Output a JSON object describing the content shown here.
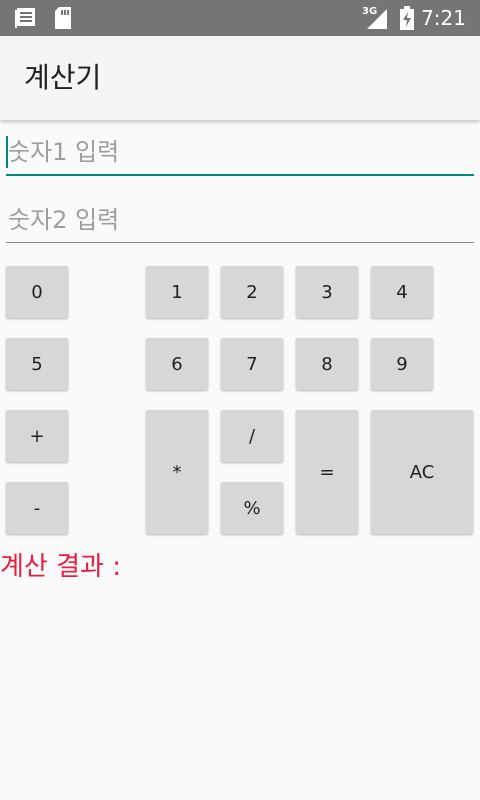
{
  "status_bar": {
    "time": "7:21",
    "network": "3G",
    "icons": [
      "notification-list-icon",
      "sd-card-icon",
      "signal-icon",
      "battery-charging-icon"
    ]
  },
  "app_bar": {
    "title": "계산기"
  },
  "inputs": {
    "number1": {
      "placeholder": "숫자1 입력",
      "value": ""
    },
    "number2": {
      "placeholder": "숫자2 입력",
      "value": ""
    }
  },
  "keypad": {
    "k0": "0",
    "k1": "1",
    "k2": "2",
    "k3": "3",
    "k4": "4",
    "k5": "5",
    "k6": "6",
    "k7": "7",
    "k8": "8",
    "k9": "9",
    "plus": "+",
    "minus": "-",
    "multiply": "*",
    "divide": "/",
    "modulo": "%",
    "equals": "=",
    "clear": "AC"
  },
  "result": {
    "label": "계산 결과 :"
  },
  "colors": {
    "status_bar": "#757575",
    "accent": "#00897b",
    "result_text": "#e91e3d",
    "button_bg": "#d6d7d7"
  }
}
